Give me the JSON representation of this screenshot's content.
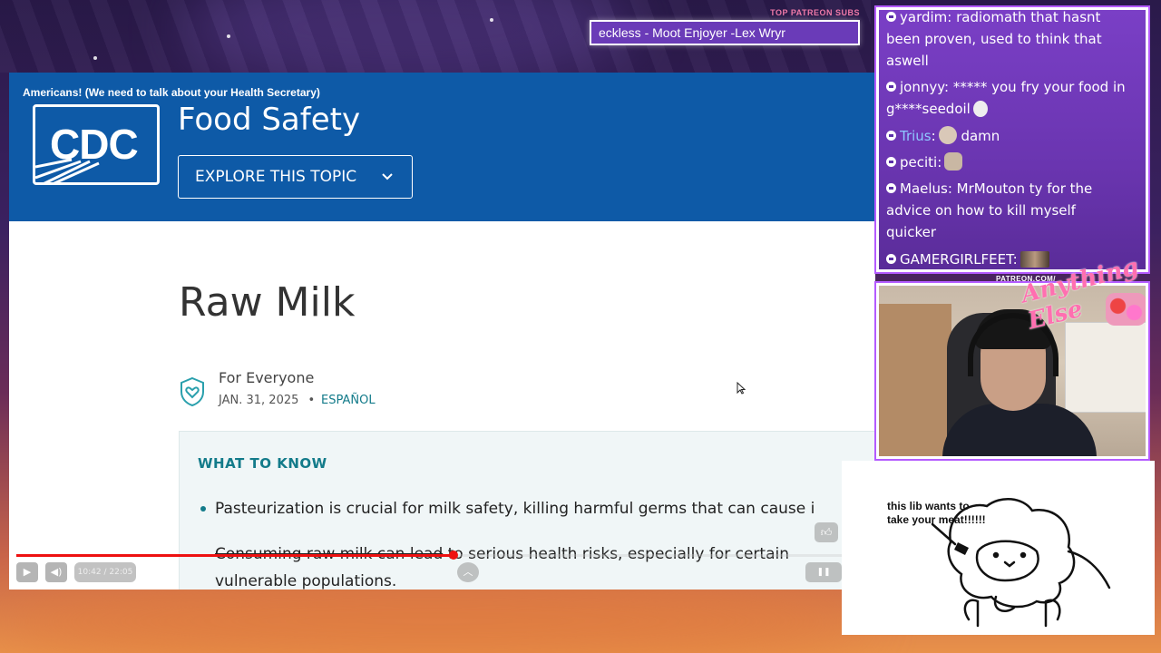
{
  "overlay": {
    "subs_label": "TOP PATREON SUBS",
    "subs_ticker": "eckless - Moot Enjoyer -Lex Wryr",
    "patreon_label": "PATREON.COM/",
    "brand_script": "Anything Else"
  },
  "video": {
    "title": "Americans! (We need to talk about your Health Secretary)",
    "time": "10:42 / 22:05",
    "progress_fraction": 0.53
  },
  "site": {
    "logo_text": "CDC",
    "title": "Food Safety",
    "explore_button": "EXPLORE THIS TOPIC"
  },
  "article": {
    "title": "Raw Milk",
    "audience": "For Everyone",
    "date": "JAN. 31, 2025",
    "separator": "•",
    "language_link": "ESPAÑOL",
    "know_heading": "WHAT TO KNOW",
    "bullet1": "Pasteurization is crucial for milk safety, killing harmful germs that can cause i",
    "bullet2_struck": "Consuming raw milk can lead",
    "bullet2_rest": " to serious health risks, especially for certain",
    "bullet2_cont": "vulnerable populations."
  },
  "chat": {
    "messages": [
      {
        "user": "yardim",
        "text": ": radiomath that hasnt"
      },
      {
        "user": "",
        "text": "been proven, used to think that"
      },
      {
        "user": "",
        "text": "aswell"
      },
      {
        "user": "jonnyy",
        "text": ": ***** you fry your food in"
      },
      {
        "user": "",
        "text": "g****seedoil"
      },
      {
        "user": "Trius",
        "text": ":"
      },
      {
        "user": "",
        "text": "damn"
      },
      {
        "user": "peciti",
        "text": ":"
      },
      {
        "user": "Maelus",
        "text": ": MrMouton ty for the"
      },
      {
        "user": "",
        "text": "advice on how to kill myself"
      },
      {
        "user": "",
        "text": "quicker"
      },
      {
        "user": "GAMERGIRLFEET",
        "text": ":"
      }
    ]
  },
  "drawing": {
    "caption": "this lib wants to take your meat!!!!!!"
  },
  "colors": {
    "cdc_blue": "#0e5aa7",
    "teal": "#137b8a",
    "chat_purple": "#6a35b0",
    "progress_red": "#ee1111"
  }
}
